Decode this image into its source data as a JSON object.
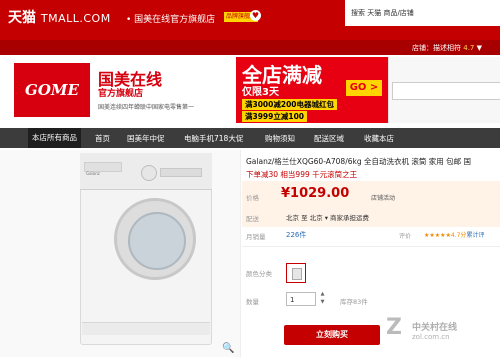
{
  "header": {
    "logo_cn": "天猫",
    "logo_en": "TMALL.COM",
    "store_name": "• 国美在线官方旗舰店",
    "store_badge": "品牌旗舰店",
    "search_text": "搜索 天猫 商品/店铺",
    "rating_label": "店铺：描述相符",
    "rating_value": "4.7",
    "rating_arrow": "▼"
  },
  "banner": {
    "logo_text": "GOME",
    "brand_name": "国美在线",
    "brand_sub": "官方旗舰店",
    "tagline": "国美连续四年蝉联中国家电零售第一",
    "promo_title": "全店满减",
    "promo_days": "仅限3天",
    "promo_go": "GO >",
    "promo_line1": "满3000减200电器城红包",
    "promo_line2": "满3999立减100"
  },
  "nav": {
    "items": [
      "本店所有商品",
      "首页",
      "国美年中促",
      "电脑手机718大促",
      "购物须知",
      "配送区域",
      "收藏本店"
    ]
  },
  "product": {
    "title": "Galanz/格兰仕XQG60-A708/6kg 全自动洗衣机 滚筒 家用 包邮 国",
    "subtitle": "下单减30 相当999 千元滚筒之王",
    "price_label": "价格",
    "price": "1029.00",
    "price_tag": "店铺活动",
    "ship_label": "配送",
    "ship_text": "北京 至 北京 ▾ 商家承担运费",
    "sales_label": "月销量",
    "sales_value": "226件",
    "review_label": "评价",
    "stars_text": "★★★★★4.7分",
    "review_count": "累计评",
    "color_label": "颜色分类",
    "qty_label": "数量",
    "qty_value": "1",
    "qty_up": "▲",
    "qty_down": "▼",
    "stock_text": "库存83件",
    "buy_label": "立刻购买",
    "washer_brand": "Galanz",
    "zoom_icon": "🔍"
  },
  "watermark": {
    "z": "Z",
    "cn": "中关村在线",
    "url": "zol.com.cn"
  }
}
